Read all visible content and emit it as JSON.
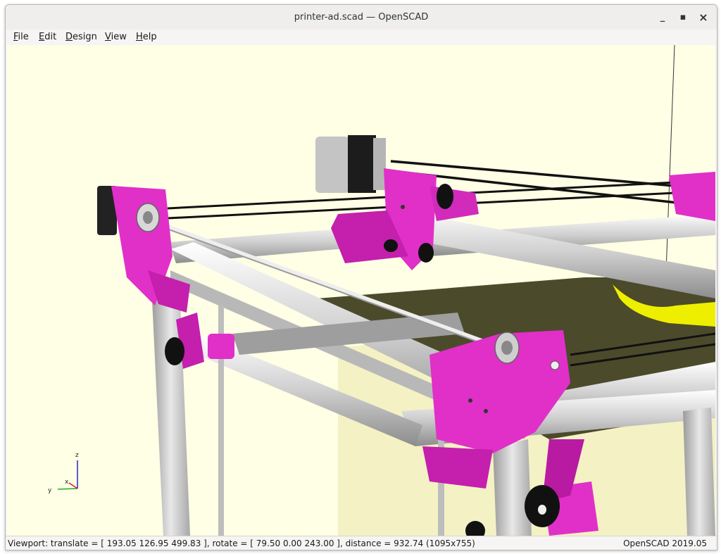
{
  "window": {
    "title": "printer-ad.scad — OpenSCAD",
    "minimize_glyph": "_",
    "maximize_glyph": "▪",
    "close_glyph": "×"
  },
  "menu": {
    "items": [
      {
        "mnemonic": "F",
        "rest": "ile"
      },
      {
        "mnemonic": "E",
        "rest": "dit"
      },
      {
        "mnemonic": "D",
        "rest": "esign"
      },
      {
        "mnemonic": "V",
        "rest": "iew"
      },
      {
        "mnemonic": "H",
        "rest": "elp"
      }
    ]
  },
  "viewport": {
    "background": "#ffffe5",
    "axes": {
      "x_label": "x",
      "y_label": "y",
      "z_label": "z"
    },
    "colors": {
      "printed_parts": "#e030c8",
      "frame_extrusion": "#d9d9d9",
      "bed": "#4a4a2a",
      "hotend_part": "#f0f000",
      "belt": "#111111"
    }
  },
  "status": {
    "viewport_text": "Viewport: translate = [ 193.05 126.95 499.83 ], rotate = [ 79.50 0.00 243.00 ], distance = 932.74 (1095x755)",
    "version": "OpenSCAD 2019.05"
  }
}
